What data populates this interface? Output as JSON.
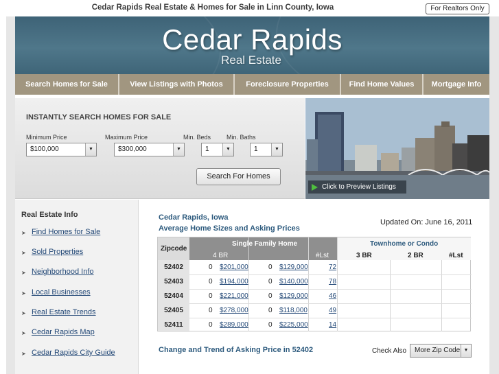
{
  "top": {
    "title": "Cedar Rapids Real Estate & Homes for Sale in Linn County, Iowa",
    "realtors_button": "For Realtors Only"
  },
  "header": {
    "logo_main": "Cedar Rapids",
    "logo_sub": "Real Estate"
  },
  "nav": [
    {
      "label": "Search Homes for Sale"
    },
    {
      "label": "View Listings with Photos"
    },
    {
      "label": "Foreclosure Properties"
    },
    {
      "label": "Find Home Values"
    },
    {
      "label": "Mortgage Info"
    }
  ],
  "search": {
    "title": "INSTANTLY SEARCH HOMES FOR SALE",
    "min_price_label": "Minimum Price",
    "min_price_value": "$100,000",
    "max_price_label": "Maximum Price",
    "max_price_value": "$300,000",
    "beds_label": "Min. Beds",
    "beds_value": "1",
    "baths_label": "Min. Baths",
    "baths_value": "1",
    "button": "Search For Homes"
  },
  "photo": {
    "preview_label": "Click to Preview Listings"
  },
  "sidebar": {
    "title": "Real Estate Info",
    "links": [
      "Find Homes for Sale",
      "Sold Properties",
      "Neighborhood Info",
      "Local Businesses",
      "Real Estate Trends",
      "Cedar Rapids Map",
      "Cedar Rapids City Guide"
    ]
  },
  "main": {
    "location": "Cedar Rapids, Iowa",
    "subtitle": "Average Home Sizes and Asking Prices",
    "updated": "Updated On: June 16, 2011",
    "change_title": "Change and Trend of Asking Price in 52402",
    "check_also": "Check Also",
    "more_zip": "More Zip Code"
  },
  "table": {
    "zip_header": "Zipcode",
    "sf_header": "Single Family Home",
    "th_header": "Townhome or Condo",
    "sub_headers": [
      "4 BR",
      "#Lst",
      "3 BR",
      "2 BR",
      "#Lst"
    ],
    "rows": [
      {
        "zip": "52402",
        "a": "0",
        "a_price": "$201,000",
        "b": "0",
        "b_price": "$129,000",
        "lst": "72"
      },
      {
        "zip": "52403",
        "a": "0",
        "a_price": "$194,000",
        "b": "0",
        "b_price": "$140,000",
        "lst": "78"
      },
      {
        "zip": "52404",
        "a": "0",
        "a_price": "$221,000",
        "b": "0",
        "b_price": "$129,000",
        "lst": "46"
      },
      {
        "zip": "52405",
        "a": "0",
        "a_price": "$278,000",
        "b": "0",
        "b_price": "$118,000",
        "lst": "49"
      },
      {
        "zip": "52411",
        "a": "0",
        "a_price": "$289,000",
        "b": "0",
        "b_price": "$225,000",
        "lst": "14"
      }
    ]
  },
  "icons": {
    "dropdown": "chevron-down-icon",
    "play": "play-icon",
    "bullet": "bullet-icon"
  }
}
